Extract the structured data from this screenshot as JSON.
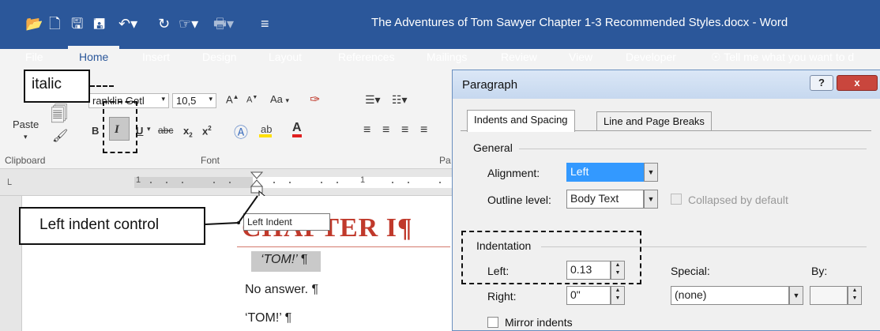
{
  "titlebar": {
    "document_title": "The Adventures of Tom Sawyer Chapter 1-3 Recommended Styles.docx  -  Word",
    "qat_icons": [
      "folder-open-icon",
      "new-document-icon",
      "save-icon",
      "save-as-icon",
      "undo-icon",
      "redo-icon",
      "touch-mode-icon",
      "print-icon",
      "customize-qat-icon"
    ]
  },
  "ribbon_tabs": [
    {
      "label": "File"
    },
    {
      "label": "Home"
    },
    {
      "label": "Insert"
    },
    {
      "label": "Design"
    },
    {
      "label": "Layout"
    },
    {
      "label": "References"
    },
    {
      "label": "Mailings"
    },
    {
      "label": "Review"
    },
    {
      "label": "View"
    },
    {
      "label": "Developer"
    }
  ],
  "tell_me": "Tell me what you want to d",
  "ribbon": {
    "paste_label": "Paste",
    "font_name": "ranklin Gotl",
    "font_size": "10,5",
    "bold": "B",
    "italic": "I",
    "underline": "U",
    "strike": "abc",
    "subscript": "x",
    "superscript": "x",
    "aa_label": "Aa",
    "grow": "A",
    "shrink": "A",
    "groups": {
      "clipboard": "Clipboard",
      "font": "Font",
      "paragraph": "Pa"
    }
  },
  "ruler": {
    "numbers": [
      "1",
      "1"
    ]
  },
  "document": {
    "heading": "CHAPTER I¶",
    "lines": [
      "‘TOM!’ ¶",
      "No answer. ¶",
      "‘TOM!’ ¶"
    ],
    "tooltip": "Left Indent"
  },
  "callouts": {
    "italic": "italic",
    "left_indent": "Left indent control"
  },
  "dialog": {
    "title": "Paragraph",
    "help_btn": "?",
    "close_btn": "x",
    "tabs": [
      "Indents and Spacing",
      "Line and Page Breaks"
    ],
    "general": {
      "section": "General",
      "alignment_label": "Alignment:",
      "alignment_value": "Left",
      "outline_label": "Outline level:",
      "outline_value": "Body Text",
      "collapsed_label": "Collapsed by default"
    },
    "indentation": {
      "section": "Indentation",
      "left_label": "Left:",
      "left_value": "0.13",
      "right_label": "Right:",
      "right_value": "0\"",
      "special_label": "Special:",
      "special_value": "(none)",
      "by_label": "By:",
      "mirror_label": "Mirror indents"
    }
  }
}
